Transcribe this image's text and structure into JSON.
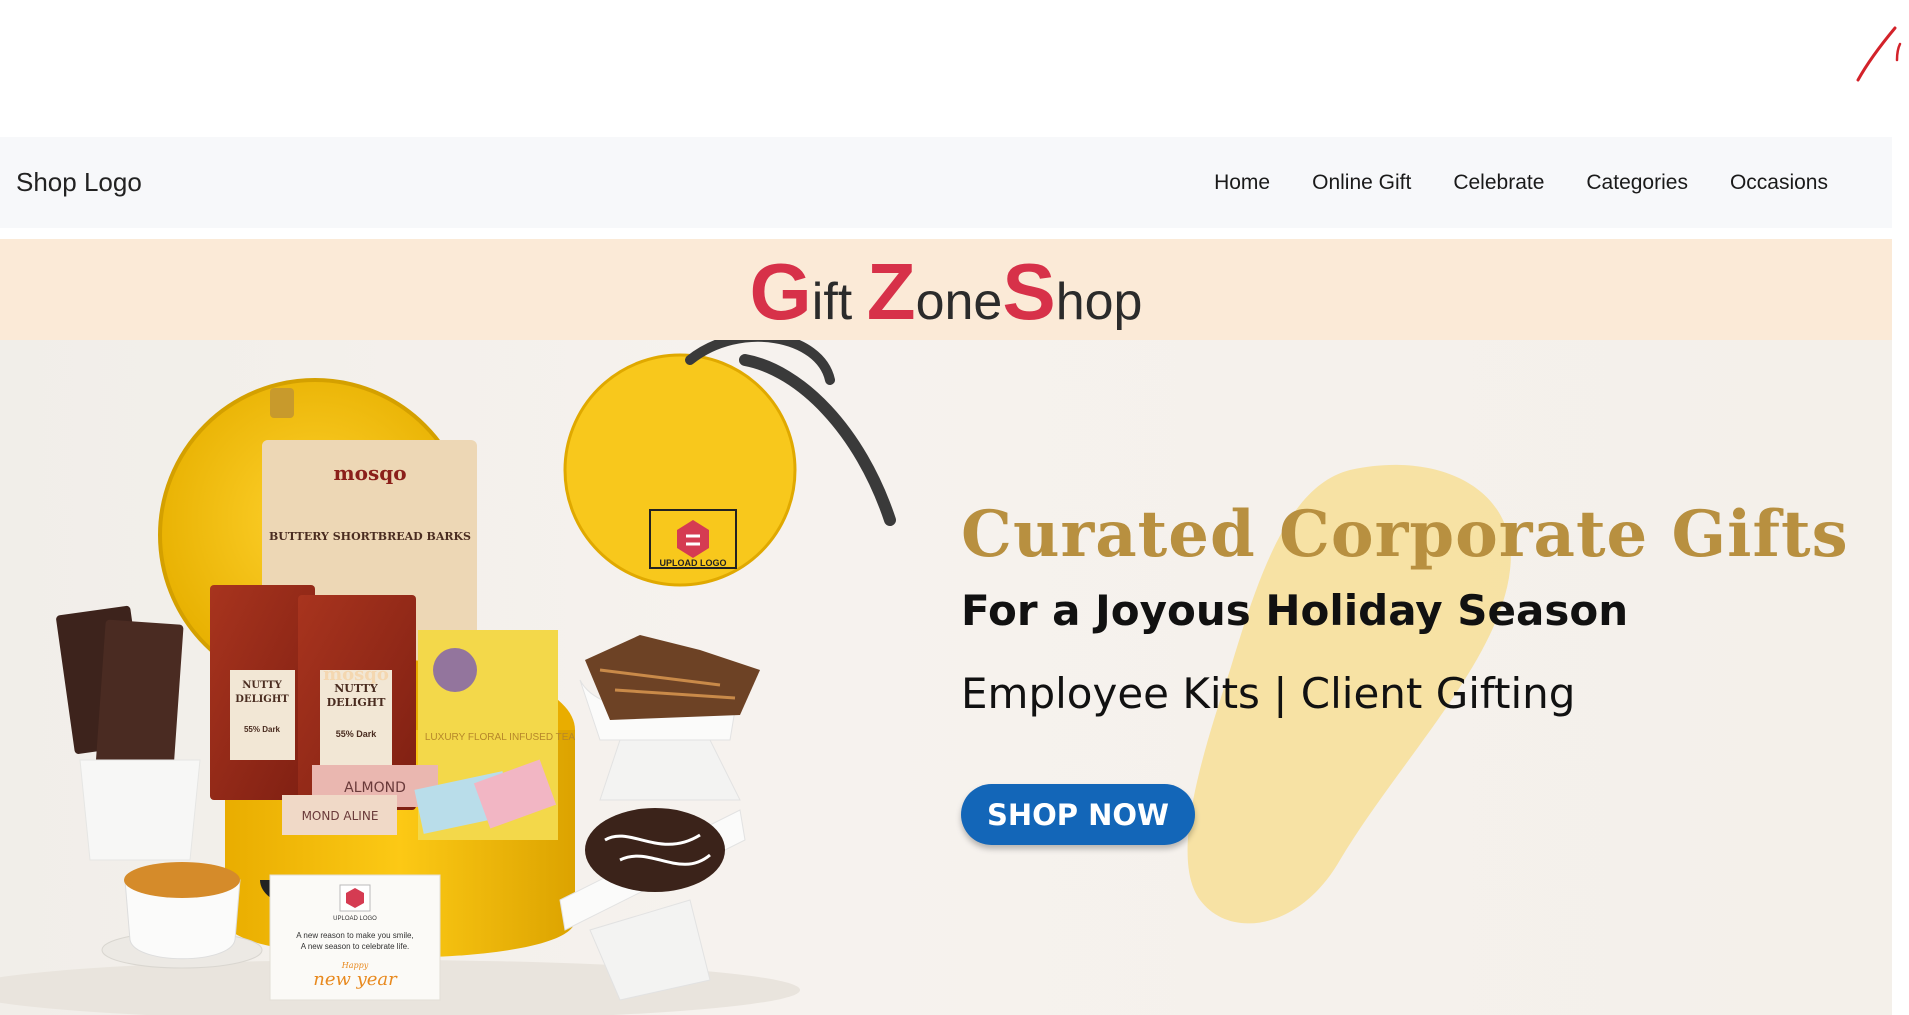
{
  "navbar": {
    "brand": "Shop Logo",
    "links": [
      "Home",
      "Online Gift",
      "Celebrate",
      "Categories",
      "Occasions"
    ]
  },
  "title_banner": {
    "parts": [
      {
        "cap": "G",
        "rest": "ift "
      },
      {
        "cap": "Z",
        "rest": "one"
      },
      {
        "cap": "S",
        "rest": "hop"
      }
    ]
  },
  "hero": {
    "heading": "Curated Corporate Gifts",
    "subheading": "For a Joyous Holiday Season",
    "tagline": "Employee Kits | Client Gifting",
    "cta_label": "SHOP NOW",
    "box_logo_label": "UPLOAD LOGO",
    "card_logo_label": "UPLOAD LOGO",
    "card_message_line1": "A new reason to make you smile,",
    "card_message_line2": "A new season to celebrate life.",
    "card_script_small": "Happy",
    "card_script": "new year",
    "pouch_brand": "mosqo",
    "pouch1_text": "BUTTERY SHORTBREAD BARKS",
    "pouch2_line1": "NUTTY",
    "pouch2_line2": "DELIGHT",
    "pouch2_dark": "55% Dark",
    "tea_box_text": "LUXURY FLORAL INFUSED TEA",
    "almond_text": "ALMOND",
    "almond2_text": "MOND ALINE"
  },
  "colors": {
    "accent_red": "#d73149",
    "gold": "#b89040",
    "cta_blue": "#1366b8",
    "banner_peach": "#fbead7",
    "navbar_bg": "#f7f8fa",
    "hamper_yellow": "#f5c518"
  }
}
